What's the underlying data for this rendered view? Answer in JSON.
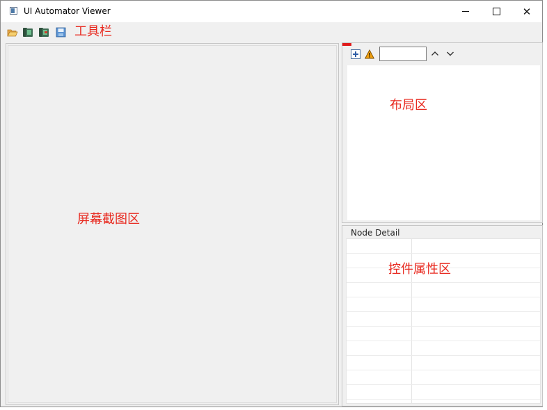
{
  "window": {
    "title": "UI Automator Viewer",
    "controls": {
      "minimize_icon": "minimize-icon",
      "maximize_icon": "maximize-icon",
      "close_icon": "close-icon"
    },
    "close_symbol": "✕"
  },
  "toolbar": {
    "note": "工具栏",
    "icons": [
      "open-folder-icon",
      "device-screenshot-icon",
      "device-screenshot-compressed-icon",
      "save-icon"
    ]
  },
  "screenshot_area": {
    "note": "屏幕截图区"
  },
  "layout_area": {
    "note": "布局区",
    "search": {
      "value": "",
      "placeholder": ""
    },
    "icons": [
      "expand-all-icon",
      "warning-icon",
      "previous-icon",
      "next-icon",
      "clear-search-icon"
    ]
  },
  "node_detail": {
    "legend": "Node Detail",
    "note": "控件属性区"
  },
  "colors": {
    "annotation": "#e8281e",
    "panel_bg": "#f0f0f0",
    "border": "#c6c6c6",
    "clear_red": "#e01b1b"
  }
}
